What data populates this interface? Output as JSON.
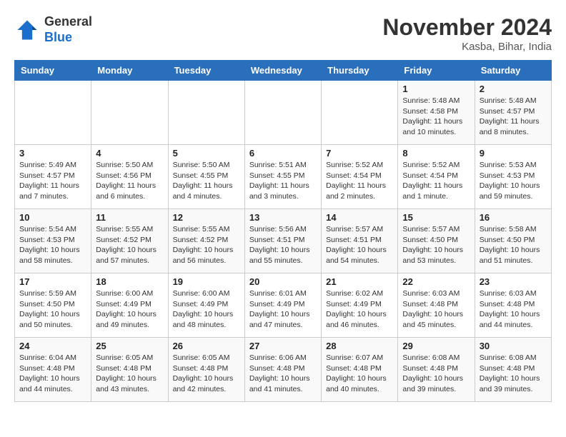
{
  "logo": {
    "general": "General",
    "blue": "Blue"
  },
  "header": {
    "month_title": "November 2024",
    "subtitle": "Kasba, Bihar, India"
  },
  "columns": [
    "Sunday",
    "Monday",
    "Tuesday",
    "Wednesday",
    "Thursday",
    "Friday",
    "Saturday"
  ],
  "weeks": [
    [
      {
        "day": "",
        "info": ""
      },
      {
        "day": "",
        "info": ""
      },
      {
        "day": "",
        "info": ""
      },
      {
        "day": "",
        "info": ""
      },
      {
        "day": "",
        "info": ""
      },
      {
        "day": "1",
        "info": "Sunrise: 5:48 AM\nSunset: 4:58 PM\nDaylight: 11 hours and 10 minutes."
      },
      {
        "day": "2",
        "info": "Sunrise: 5:48 AM\nSunset: 4:57 PM\nDaylight: 11 hours and 8 minutes."
      }
    ],
    [
      {
        "day": "3",
        "info": "Sunrise: 5:49 AM\nSunset: 4:57 PM\nDaylight: 11 hours and 7 minutes."
      },
      {
        "day": "4",
        "info": "Sunrise: 5:50 AM\nSunset: 4:56 PM\nDaylight: 11 hours and 6 minutes."
      },
      {
        "day": "5",
        "info": "Sunrise: 5:50 AM\nSunset: 4:55 PM\nDaylight: 11 hours and 4 minutes."
      },
      {
        "day": "6",
        "info": "Sunrise: 5:51 AM\nSunset: 4:55 PM\nDaylight: 11 hours and 3 minutes."
      },
      {
        "day": "7",
        "info": "Sunrise: 5:52 AM\nSunset: 4:54 PM\nDaylight: 11 hours and 2 minutes."
      },
      {
        "day": "8",
        "info": "Sunrise: 5:52 AM\nSunset: 4:54 PM\nDaylight: 11 hours and 1 minute."
      },
      {
        "day": "9",
        "info": "Sunrise: 5:53 AM\nSunset: 4:53 PM\nDaylight: 10 hours and 59 minutes."
      }
    ],
    [
      {
        "day": "10",
        "info": "Sunrise: 5:54 AM\nSunset: 4:53 PM\nDaylight: 10 hours and 58 minutes."
      },
      {
        "day": "11",
        "info": "Sunrise: 5:55 AM\nSunset: 4:52 PM\nDaylight: 10 hours and 57 minutes."
      },
      {
        "day": "12",
        "info": "Sunrise: 5:55 AM\nSunset: 4:52 PM\nDaylight: 10 hours and 56 minutes."
      },
      {
        "day": "13",
        "info": "Sunrise: 5:56 AM\nSunset: 4:51 PM\nDaylight: 10 hours and 55 minutes."
      },
      {
        "day": "14",
        "info": "Sunrise: 5:57 AM\nSunset: 4:51 PM\nDaylight: 10 hours and 54 minutes."
      },
      {
        "day": "15",
        "info": "Sunrise: 5:57 AM\nSunset: 4:50 PM\nDaylight: 10 hours and 53 minutes."
      },
      {
        "day": "16",
        "info": "Sunrise: 5:58 AM\nSunset: 4:50 PM\nDaylight: 10 hours and 51 minutes."
      }
    ],
    [
      {
        "day": "17",
        "info": "Sunrise: 5:59 AM\nSunset: 4:50 PM\nDaylight: 10 hours and 50 minutes."
      },
      {
        "day": "18",
        "info": "Sunrise: 6:00 AM\nSunset: 4:49 PM\nDaylight: 10 hours and 49 minutes."
      },
      {
        "day": "19",
        "info": "Sunrise: 6:00 AM\nSunset: 4:49 PM\nDaylight: 10 hours and 48 minutes."
      },
      {
        "day": "20",
        "info": "Sunrise: 6:01 AM\nSunset: 4:49 PM\nDaylight: 10 hours and 47 minutes."
      },
      {
        "day": "21",
        "info": "Sunrise: 6:02 AM\nSunset: 4:49 PM\nDaylight: 10 hours and 46 minutes."
      },
      {
        "day": "22",
        "info": "Sunrise: 6:03 AM\nSunset: 4:48 PM\nDaylight: 10 hours and 45 minutes."
      },
      {
        "day": "23",
        "info": "Sunrise: 6:03 AM\nSunset: 4:48 PM\nDaylight: 10 hours and 44 minutes."
      }
    ],
    [
      {
        "day": "24",
        "info": "Sunrise: 6:04 AM\nSunset: 4:48 PM\nDaylight: 10 hours and 44 minutes."
      },
      {
        "day": "25",
        "info": "Sunrise: 6:05 AM\nSunset: 4:48 PM\nDaylight: 10 hours and 43 minutes."
      },
      {
        "day": "26",
        "info": "Sunrise: 6:05 AM\nSunset: 4:48 PM\nDaylight: 10 hours and 42 minutes."
      },
      {
        "day": "27",
        "info": "Sunrise: 6:06 AM\nSunset: 4:48 PM\nDaylight: 10 hours and 41 minutes."
      },
      {
        "day": "28",
        "info": "Sunrise: 6:07 AM\nSunset: 4:48 PM\nDaylight: 10 hours and 40 minutes."
      },
      {
        "day": "29",
        "info": "Sunrise: 6:08 AM\nSunset: 4:48 PM\nDaylight: 10 hours and 39 minutes."
      },
      {
        "day": "30",
        "info": "Sunrise: 6:08 AM\nSunset: 4:48 PM\nDaylight: 10 hours and 39 minutes."
      }
    ]
  ]
}
